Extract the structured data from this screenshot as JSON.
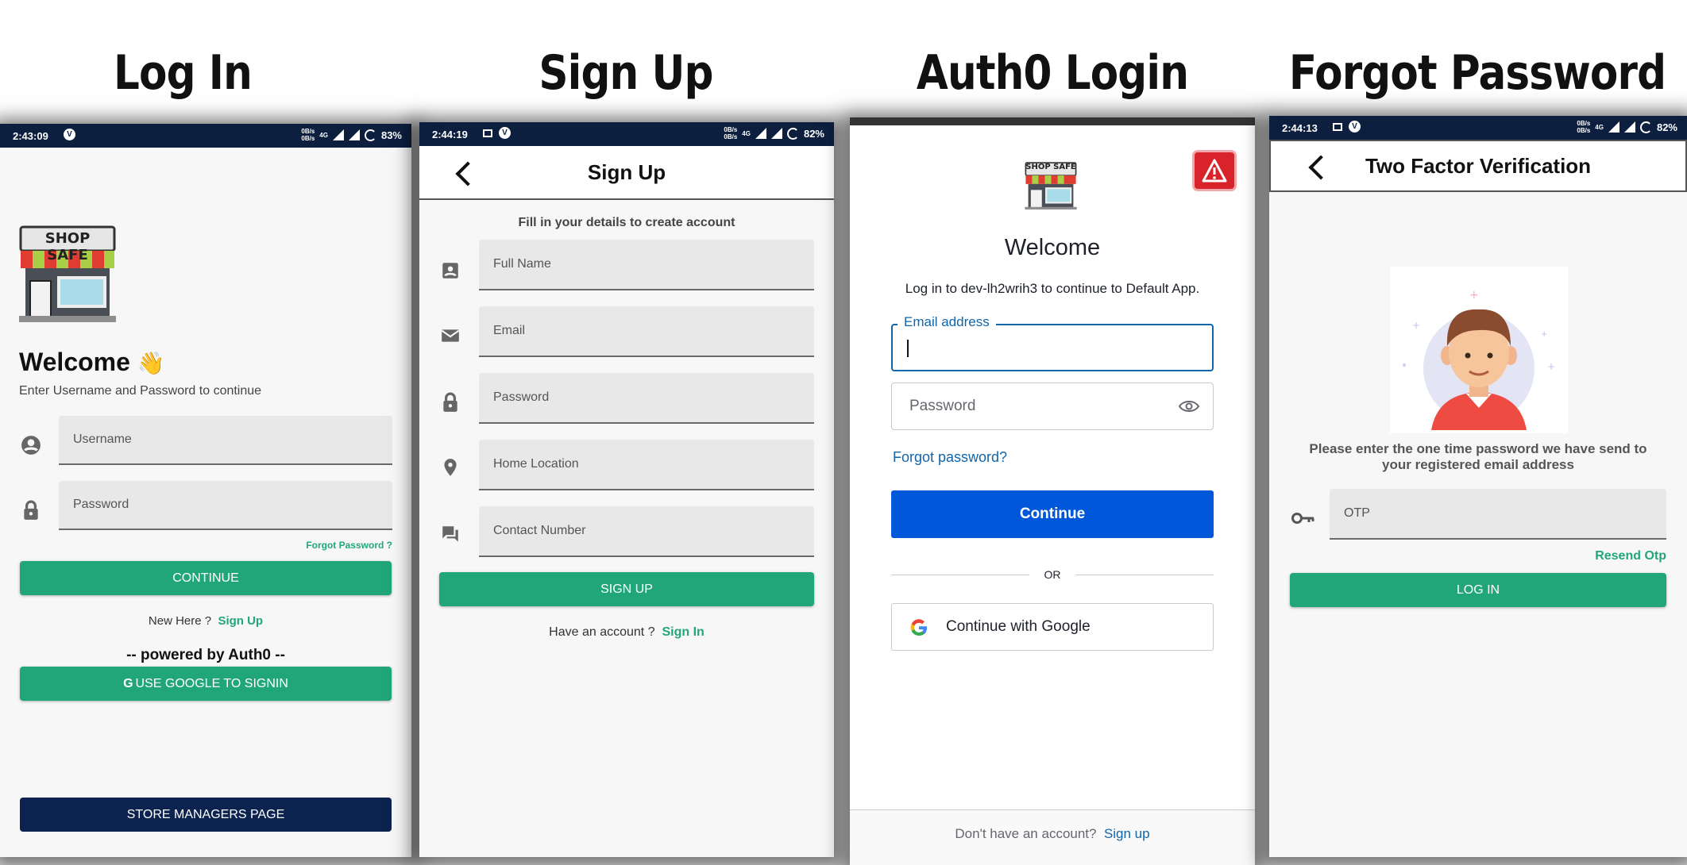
{
  "titles": [
    "Log In",
    "Sign Up",
    "Auth0 Login",
    "Forgot Password"
  ],
  "status": {
    "login": {
      "time": "2:43:09",
      "battery": "83%",
      "rate_top": "0B/s",
      "rate_bottom": "0B/s",
      "net": "4G"
    },
    "signup": {
      "time": "2:44:19",
      "battery": "82%",
      "rate_top": "0B/s",
      "rate_bottom": "0B/s",
      "net": "4G"
    },
    "forgot": {
      "time": "2:44:13",
      "battery": "82%",
      "rate_top": "0B/s",
      "rate_bottom": "0B/s",
      "net": "4G"
    },
    "vpn_glyph": "V"
  },
  "login": {
    "logo_text": "SHOP SAFE",
    "welcome": "Welcome",
    "wave_emoji": "👋",
    "subtitle": "Enter Username and Password to continue",
    "username_placeholder": "Username",
    "password_placeholder": "Password",
    "forgot_link": "Forgot Password ?",
    "continue_label": "CONTINUE",
    "new_here": "New Here ?",
    "sign_up_link": "Sign Up",
    "powered_by": "-- powered by Auth0 --",
    "google_g": "G",
    "google_label": "USE GOOGLE TO SIGNIN",
    "store_managers_label": "STORE MANAGERS PAGE"
  },
  "signup": {
    "title": "Sign Up",
    "subtitle": "Fill in your details to create account",
    "fields": [
      "Full Name",
      "Email",
      "Password",
      "Home Location",
      "Contact Number"
    ],
    "button": "SIGN UP",
    "have_account": "Have an account ?",
    "sign_in_link": "Sign In"
  },
  "auth0": {
    "logo_text": "SHOP SAFE",
    "welcome": "Welcome",
    "description": "Log in to dev-lh2wrih3 to continue to Default App.",
    "email_label": "Email address",
    "password_placeholder": "Password",
    "forgot": "Forgot password?",
    "continue_label": "Continue",
    "or": "OR",
    "google_label": "Continue with Google",
    "no_account": "Don't have an account?",
    "sign_up_link": "Sign up"
  },
  "forgot": {
    "title": "Two Factor Verification",
    "message_line1": "Please enter the one time password we have send to",
    "message_line2": "your registered email address",
    "otp_placeholder": "OTP",
    "resend": "Resend Otp",
    "login_label": "LOG IN"
  },
  "colors": {
    "green": "#21a67a",
    "navy": "#0c2350",
    "statusbar": "#0c1f3f",
    "auth0_blue": "#0057d9",
    "auth0_link": "#1265a8",
    "warning_red": "#d8232a"
  },
  "icons": {
    "login_fields": [
      "account-circle-icon",
      "lock-icon"
    ],
    "signup_fields": [
      "contact-card-icon",
      "email-icon",
      "lock-icon",
      "location-pin-icon",
      "chat-icon"
    ],
    "password_toggle": "eye-icon",
    "warning": "warning-triangle-icon",
    "otp": "key-icon"
  }
}
